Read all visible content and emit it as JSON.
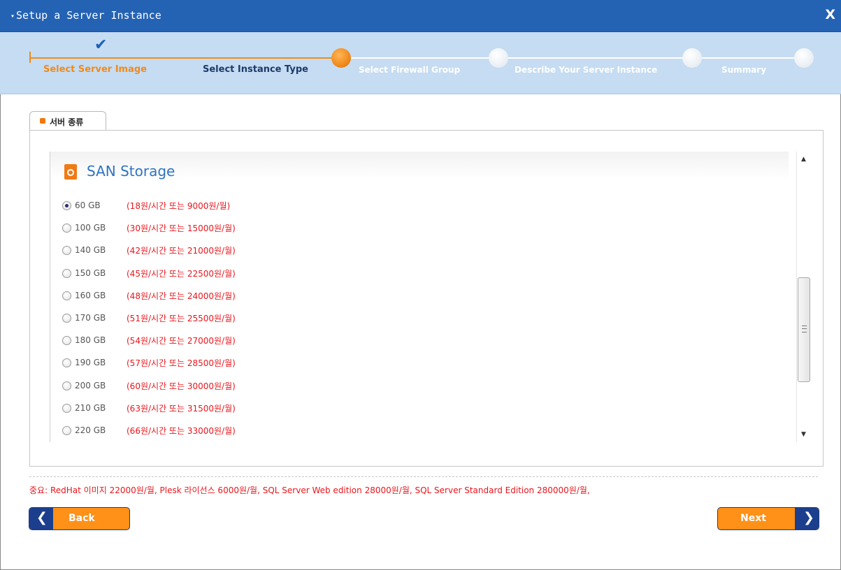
{
  "window": {
    "title": "Setup a Server Instance",
    "title_arrow": "▾",
    "close_label": "X"
  },
  "wizard": {
    "check_icon": "✔",
    "steps": [
      {
        "label": "Select Server Image",
        "state": "done"
      },
      {
        "label": "Select Instance Type",
        "state": "current"
      },
      {
        "label": "Select Firewall Group",
        "state": "todo"
      },
      {
        "label": "Describe Your Server Instance",
        "state": "todo"
      },
      {
        "label": "Summary",
        "state": "todo"
      }
    ]
  },
  "tab": {
    "label": "서버 종류"
  },
  "storage": {
    "title": "SAN Storage",
    "icon": "disk-icon",
    "options": [
      {
        "size": "60 GB",
        "price": "(18원/시간 또는 9000원/월)",
        "selected": true
      },
      {
        "size": "100 GB",
        "price": "(30원/시간 또는 15000원/월)",
        "selected": false
      },
      {
        "size": "140 GB",
        "price": "(42원/시간 또는 21000원/월)",
        "selected": false
      },
      {
        "size": "150 GB",
        "price": "(45원/시간 또는 22500원/월)",
        "selected": false
      },
      {
        "size": "160 GB",
        "price": "(48원/시간 또는 24000원/월)",
        "selected": false
      },
      {
        "size": "170 GB",
        "price": "(51원/시간 또는 25500원/월)",
        "selected": false
      },
      {
        "size": "180 GB",
        "price": "(54원/시간 또는 27000원/월)",
        "selected": false
      },
      {
        "size": "190 GB",
        "price": "(57원/시간 또는 28500원/월)",
        "selected": false
      },
      {
        "size": "200 GB",
        "price": "(60원/시간 또는 30000원/월)",
        "selected": false
      },
      {
        "size": "210 GB",
        "price": "(63원/시간 또는 31500원/월)",
        "selected": false
      },
      {
        "size": "220 GB",
        "price": "(66원/시간 또는 33000원/월)",
        "selected": false
      }
    ]
  },
  "scrollbar": {
    "up": "▲",
    "down": "▼"
  },
  "notice": "중요: RedHat 이미지 22000원/월, Plesk 라이선스 6000원/월, SQL Server Web edition 28000원/월, SQL Server Standard Edition 280000원/월,",
  "buttons": {
    "back_label": "Back",
    "back_arrow": "❮",
    "next_label": "Next",
    "next_arrow": "❯"
  },
  "colors": {
    "titlebar": "#2462b4",
    "stepbar": "#c5dcf2",
    "accent_orange": "#f08a1c",
    "price_red": "#e8161d",
    "storage_blue": "#2f74c0"
  }
}
